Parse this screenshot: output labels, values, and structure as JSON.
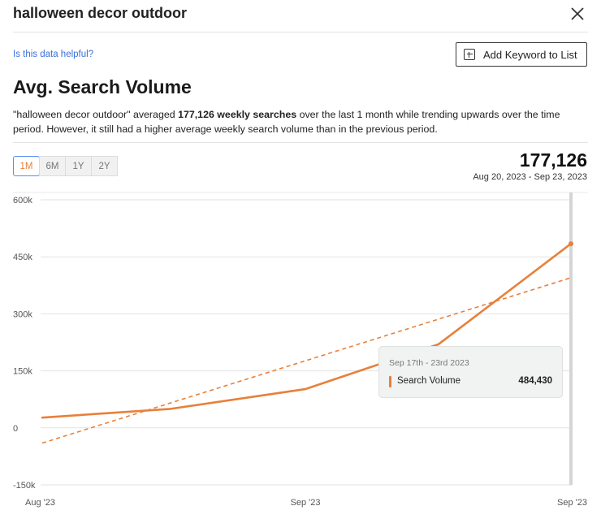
{
  "header": {
    "title": "halloween decor outdoor"
  },
  "helpful_link": "Is this data helpful?",
  "add_button": {
    "label": "Add Keyword to List"
  },
  "section": {
    "title": "Avg. Search Volume",
    "description_parts": {
      "quote": "\"halloween decor outdoor\" averaged ",
      "bold": "177,126 weekly searches",
      "rest": " over the last 1 month while trending upwards over the time period. However, it still had a higher average weekly search volume than in the previous period."
    }
  },
  "range_tabs": [
    {
      "label": "1M",
      "active": true
    },
    {
      "label": "6M",
      "active": false
    },
    {
      "label": "1Y",
      "active": false
    },
    {
      "label": "2Y",
      "active": false
    }
  ],
  "summary": {
    "value": "177,126",
    "date_range": "Aug 20, 2023 - Sep 23, 2023"
  },
  "tooltip": {
    "date": "Sep 17th - 23rd 2023",
    "series": "Search Volume",
    "value": "484,430"
  },
  "colors": {
    "series": "#e8803a",
    "grid": "#e2e2e2",
    "axis_text": "#555555",
    "link": "#3b6fd8",
    "active_tab_border": "#5b8def"
  },
  "icons": {
    "close": "close-icon",
    "add": "plus-square-icon"
  },
  "chart_data": {
    "type": "line",
    "title": "",
    "xlabel": "",
    "ylabel": "",
    "x_tick_labels": [
      "Aug '23",
      "Sep '23",
      "Sep '23"
    ],
    "y_tick_labels": [
      "600k",
      "450k",
      "300k",
      "150k",
      "0",
      "-150k"
    ],
    "ylim": [
      -150000,
      600000
    ],
    "grid": true,
    "series": [
      {
        "name": "Search Volume",
        "style": "solid",
        "x": [
          "Aug 20-26 2023",
          "Aug 27-Sep 2 2023",
          "Sep 3-9 2023",
          "Sep 10-16 2023",
          "Sep 17-23 2023"
        ],
        "values": [
          27000,
          50000,
          102000,
          220000,
          484430
        ]
      },
      {
        "name": "",
        "style": "dashed",
        "x": [
          "Aug 20-26 2023",
          "Sep 17-23 2023"
        ],
        "values": [
          -40000,
          395000
        ]
      }
    ],
    "highlight_index": 4
  }
}
